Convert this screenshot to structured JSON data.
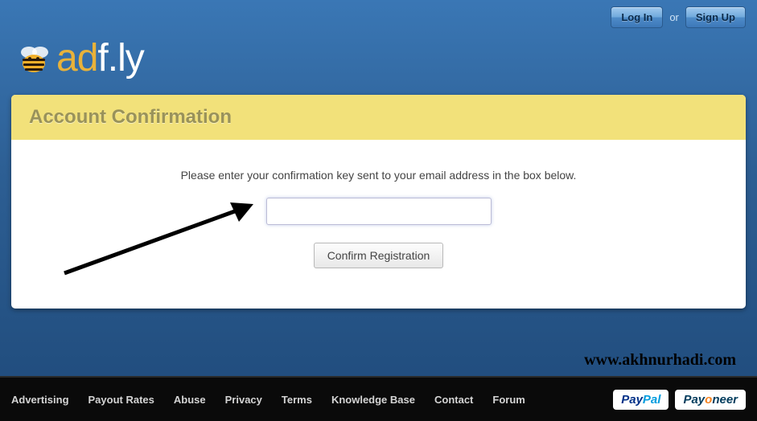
{
  "top": {
    "login_label": "Log In",
    "or_label": "or",
    "signup_label": "Sign Up"
  },
  "logo": {
    "text_a": "a",
    "text_d": "d",
    "text_f": "f",
    "text_dot": ".",
    "text_l": "l",
    "text_y": "y"
  },
  "card": {
    "title": "Account Confirmation",
    "instruction": "Please enter your confirmation key sent to your email address in the box below.",
    "input_value": "",
    "confirm_label": "Confirm Registration"
  },
  "watermark": "www.akhnurhadi.com",
  "footer": {
    "links": [
      "Advertising",
      "Payout Rates",
      "Abuse",
      "Privacy",
      "Terms",
      "Knowledge Base",
      "Contact",
      "Forum"
    ],
    "paypal_pay": "Pay",
    "paypal_pal": "Pal",
    "payoneer_pay": "Pa",
    "payoneer_o": "o",
    "payoneer_neer": "neer",
    "payoneer_prefix_y": "y"
  }
}
